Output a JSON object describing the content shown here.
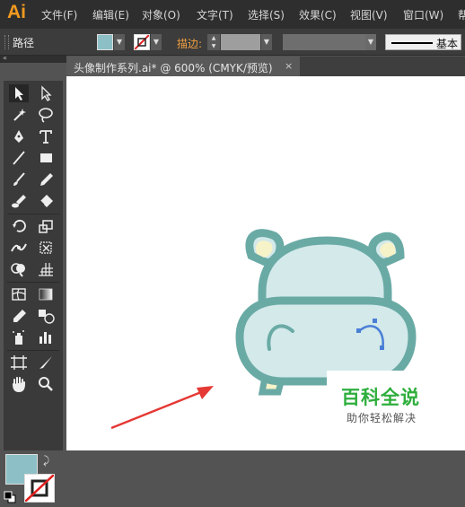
{
  "app": {
    "logo": "Ai"
  },
  "menu": [
    "文件(F)",
    "编辑(E)",
    "对象(O)",
    "文字(T)",
    "选择(S)",
    "效果(C)",
    "视图(V)",
    "窗口(W)",
    "帮"
  ],
  "control_bar": {
    "selection_label": "路径",
    "stroke_label": "描边:",
    "brush_label": "基本",
    "fill_color": "#8cc0c6"
  },
  "document": {
    "tab_title": "头像制作系列.ai* @ 600% (CMYK/预览)",
    "close_glyph": "×"
  },
  "toolbox": {
    "tools": [
      "selection-tool",
      "direct-selection-tool",
      "magic-wand-tool",
      "lasso-tool",
      "pen-tool",
      "type-tool",
      "line-segment-tool",
      "rectangle-tool",
      "paintbrush-tool",
      "pencil-tool",
      "blob-brush-tool",
      "eraser-tool",
      "rotate-tool",
      "scale-tool",
      "width-tool",
      "free-transform-tool",
      "shape-builder-tool",
      "perspective-grid-tool",
      "mesh-tool",
      "gradient-tool",
      "eyedropper-tool",
      "blend-tool",
      "symbol-sprayer-tool",
      "column-graph-tool",
      "artboard-tool",
      "slice-tool",
      "hand-tool",
      "zoom-tool"
    ],
    "fill_color": "#8cc0c6"
  },
  "artwork": {
    "colors": {
      "outline": "#6aaaa5",
      "face": "#d3e9ea",
      "ear_inner": "#f7f3c9",
      "path_highlight": "#4a7fd6",
      "arrow": "#e53935"
    }
  },
  "watermark": {
    "title": "百科全说",
    "subtitle": "助你轻松解决"
  }
}
